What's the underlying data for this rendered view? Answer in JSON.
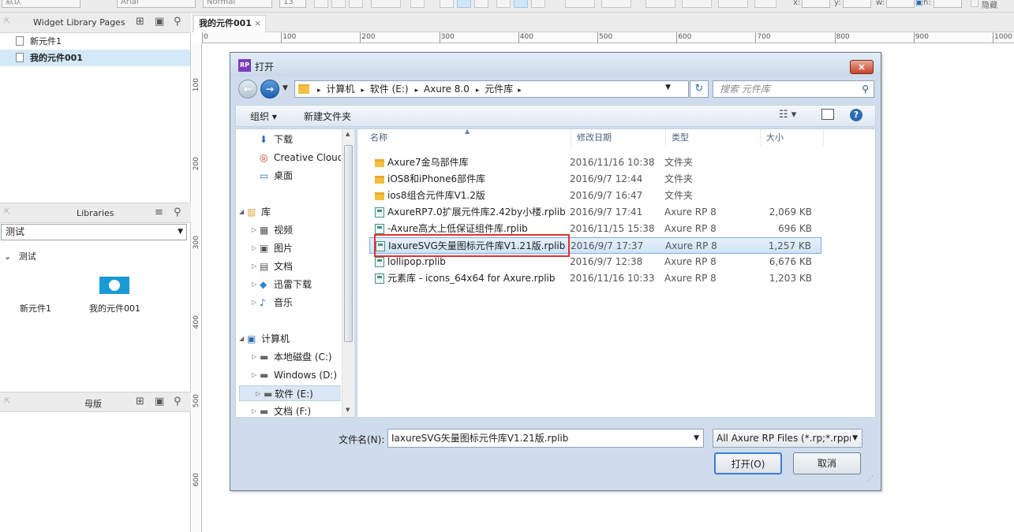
{
  "toolbar": {
    "style_value": "默认",
    "font_value": "Arial",
    "weight_value": "Normal",
    "size_value": "13",
    "x_label": "x:",
    "y_label": "y:",
    "w_label": "w:",
    "h_label": "h:",
    "hide_label": "隐藏"
  },
  "pages_panel": {
    "title": "Widget Library Pages",
    "items": [
      {
        "label": "新元件1"
      },
      {
        "label": "我的元件001"
      }
    ]
  },
  "libraries_panel": {
    "title": "Libraries",
    "selected_library": "测试",
    "group_name": "测试",
    "widgets": [
      {
        "label": "新元件1"
      },
      {
        "label": "我的元件001"
      }
    ]
  },
  "masters_panel": {
    "title": "母版"
  },
  "canvas": {
    "tab_label": "我的元件001",
    "tab_close": "×",
    "h_ticks": [
      "0",
      "100",
      "200",
      "300",
      "400",
      "500",
      "600",
      "700",
      "800",
      "900",
      "1000"
    ],
    "v_ticks": [
      "100",
      "200",
      "300",
      "400",
      "500",
      "600"
    ]
  },
  "dialog": {
    "title": "打开",
    "title_badge": "RP",
    "close_glyph": "×",
    "breadcrumb": [
      "计算机",
      "软件 (E:)",
      "Axure 8.0",
      "元件库"
    ],
    "search_placeholder": "搜索 元件库",
    "organize_label": "组织 ▾",
    "new_folder_label": "新建文件夹",
    "nav_items": [
      {
        "label": "下载",
        "indent": 1,
        "icon": "download-folder-icon"
      },
      {
        "label": "Creative Cloud",
        "indent": 1,
        "icon": "creative-cloud-icon"
      },
      {
        "label": "桌面",
        "indent": 1,
        "icon": "desktop-icon"
      },
      {
        "label": "库",
        "indent": 0,
        "icon": "library-icon"
      },
      {
        "label": "视频",
        "indent": 1,
        "icon": "video-icon"
      },
      {
        "label": "图片",
        "indent": 1,
        "icon": "picture-icon"
      },
      {
        "label": "文档",
        "indent": 1,
        "icon": "document-icon"
      },
      {
        "label": "迅雷下载",
        "indent": 1,
        "icon": "thunder-icon"
      },
      {
        "label": "音乐",
        "indent": 1,
        "icon": "music-icon"
      },
      {
        "label": "计算机",
        "indent": 0,
        "icon": "computer-icon"
      },
      {
        "label": "本地磁盘 (C:)",
        "indent": 1,
        "icon": "drive-icon"
      },
      {
        "label": "Windows (D:)",
        "indent": 1,
        "icon": "drive-icon"
      },
      {
        "label": "软件 (E:)",
        "indent": 1,
        "icon": "drive-icon"
      },
      {
        "label": "文档 (F:)",
        "indent": 1,
        "icon": "drive-icon"
      }
    ],
    "columns": [
      "名称",
      "修改日期",
      "类型",
      "大小"
    ],
    "files": [
      {
        "name": "Axure7金乌部件库",
        "date": "2016/11/16 10:38",
        "type": "文件夹",
        "size": "",
        "kind": "folder"
      },
      {
        "name": "iOS8和iPhone6部件库",
        "date": "2016/9/7 12:44",
        "type": "文件夹",
        "size": "",
        "kind": "folder"
      },
      {
        "name": "ios8组合元件库V1.2版",
        "date": "2016/9/7 16:47",
        "type": "文件夹",
        "size": "",
        "kind": "folder"
      },
      {
        "name": "AxureRP7.0扩展元件库2.42by小楼.rplib",
        "date": "2016/9/7 17:41",
        "type": "Axure RP 8",
        "size": "2,069 KB",
        "kind": "rplib"
      },
      {
        "name": "-Axure高大上低保证组件库.rplib",
        "date": "2016/11/15 15:38",
        "type": "Axure RP 8",
        "size": "696 KB",
        "kind": "rplib"
      },
      {
        "name": "IaxureSVG矢量图标元件库V1.21版.rplib",
        "date": "2016/9/7 17:37",
        "type": "Axure RP 8",
        "size": "1,257 KB",
        "kind": "rplib",
        "selected": true
      },
      {
        "name": "lollipop.rplib",
        "date": "2016/9/7 12:38",
        "type": "Axure RP 8",
        "size": "6,676 KB",
        "kind": "rplib"
      },
      {
        "name": "元素库 - icons_64x64 for Axure.rplib",
        "date": "2016/11/16 10:33",
        "type": "Axure RP 8",
        "size": "1,203 KB",
        "kind": "rplib"
      }
    ],
    "filename_label": "文件名(N):",
    "filename_value": "IaxureSVG矢量图标元件库V1.21版.rplib",
    "filetype_value": "All Axure RP Files (*.rp;*.rppr",
    "open_label": "打开(O)",
    "cancel_label": "取消"
  },
  "colors": {
    "accent": "#1a9ad6",
    "selection": "#d3e9f7",
    "highlight_box": "#e03030"
  }
}
